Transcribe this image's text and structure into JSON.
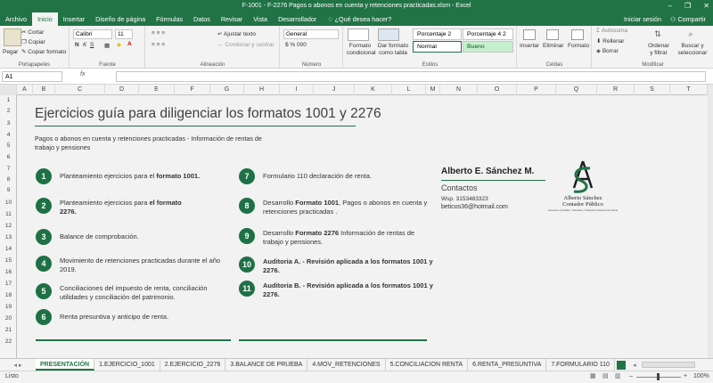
{
  "window": {
    "title": "F-1001 - F-2276 Pagos o abonos en cuenta y retenciones practicadas.xlsm - Excel",
    "controls": [
      "–",
      "❐",
      "✕"
    ]
  },
  "ribbon_tabs": [
    "Archivo",
    "Inicio",
    "Insertar",
    "Diseño de página",
    "Fórmulas",
    "Datos",
    "Revisar",
    "Vista",
    "Desarrollador"
  ],
  "tell_me": "¿Qué desea hacer?",
  "account": {
    "signin": "Iniciar sesión",
    "share": "Compartir"
  },
  "ribbon": {
    "clipboard": {
      "paste": "Pegar",
      "cut": "Cortar",
      "copy": "Copiar",
      "format_painter": "Copiar formato",
      "label": "Portapapeles"
    },
    "font": {
      "name": "Calibri",
      "size": "11",
      "label": "Fuente"
    },
    "alignment": {
      "wrap": "Ajustar texto",
      "merge": "Combinar y centrar",
      "label": "Alineación"
    },
    "number": {
      "format": "General",
      "label": "Número"
    },
    "styles": {
      "cond_format": "Formato condicional",
      "format_table": "Dar formato como tabla",
      "pct2": "Porcentaje 2",
      "pct4": "Porcentaje 4 2",
      "normal": "Normal",
      "good": "Bueno",
      "label": "Estilos"
    },
    "cells": {
      "insert": "Insertar",
      "delete": "Eliminar",
      "format": "Formato",
      "label": "Celdas"
    },
    "editing": {
      "autosum": "Autosuma",
      "fill": "Rellenar",
      "clear": "Borrar",
      "sort": "Ordenar y filtrar",
      "find": "Buscar y seleccionar",
      "label": "Modificar"
    }
  },
  "formula_bar": {
    "namebox": "A1",
    "fx": "fx",
    "value": ""
  },
  "columns": [
    "A",
    "B",
    "C",
    "D",
    "E",
    "F",
    "G",
    "H",
    "I",
    "J",
    "K",
    "L",
    "M",
    "N",
    "O",
    "P",
    "Q",
    "R",
    "S",
    "T"
  ],
  "rows": [
    "1",
    "2",
    "3",
    "4",
    "5",
    "6",
    "7",
    "8",
    "9",
    "10",
    "11",
    "12",
    "13",
    "14",
    "15",
    "16",
    "17",
    "18",
    "19",
    "20",
    "21",
    "22"
  ],
  "sheet": {
    "title": "Ejercicios guía para diligenciar los formatos 1001 y 2276",
    "subtitle": "Pagos o abonos en cuenta y retenciones practicadas - Información de rentas de trabajo y pensiones",
    "items_left": [
      {
        "n": "1",
        "pre": "Planteamiento ejercicios para el ",
        "bold": "formato 1001.",
        "post": ""
      },
      {
        "n": "2",
        "pre": "Planteamiento ejercicios para ",
        "bold": "el formato 2276.",
        "post": ""
      },
      {
        "n": "3",
        "pre": "Balance de comprobación.",
        "bold": "",
        "post": ""
      },
      {
        "n": "4",
        "pre": "Movimiento de retenciones practicadas durante el año 2019.",
        "bold": "",
        "post": ""
      },
      {
        "n": "5",
        "pre": "Conciliaciones del impuesto de renta, conciliación utilidades y conciliación del patrimonio.",
        "bold": "",
        "post": ""
      },
      {
        "n": "6",
        "pre": "Renta presuntiva y anticipo de renta.",
        "bold": "",
        "post": ""
      }
    ],
    "items_right": [
      {
        "n": "7",
        "pre": "Formulario 110 declaración de renta.",
        "bold": "",
        "post": ""
      },
      {
        "n": "8",
        "pre": "Desarrollo ",
        "bold": "Formato 1001",
        "post": ", Pagos o abonos en cuenta y retenciones practicadas ."
      },
      {
        "n": "9",
        "pre": "Desarrollo ",
        "bold": "Formato 2276",
        "post": " Información de rentas de trabajo y pensiones."
      },
      {
        "n": "10",
        "pre": "",
        "bold": "Auditoria A. - Revisión aplicada a los formatos 1001 y 2276.",
        "post": ""
      },
      {
        "n": "11",
        "pre": "",
        "bold": "Auditoria B. - Revisión aplicada a los formatos 1001 y 2276.",
        "post": ""
      }
    ],
    "card": {
      "name": "Alberto E. Sánchez M.",
      "contact_label": "Contactos",
      "phone": "Wsp. 3153483323",
      "email": "beticos36@hotmail.com",
      "logo_name": "Alberto Sánchez",
      "logo_title": "Contador Público",
      "logo_tag": "Asesoría Contable, Tributaria, Tributaria & Revisoría Fiscal"
    }
  },
  "sheet_tabs": [
    "PRESENTACIÓN",
    "1.EJERCICIO_1001",
    "2.EJERCICIO_2276",
    "3.BALANCE DE PRUEBA",
    "4.MOV_RETENCIONES",
    "5.CONCILIACION RENTA",
    "6.RENTA_PRESUNTIVA",
    "7.FORMULARIO 110"
  ],
  "status": {
    "mode": "Listo",
    "zoom": "100%"
  },
  "colors": {
    "excel_green": "#217346",
    "badge_green": "#1e7145"
  }
}
